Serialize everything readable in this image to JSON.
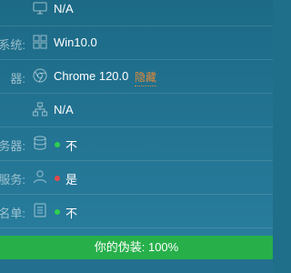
{
  "colors": {
    "background": "#1f6f8b",
    "accent_link": "#e08a3a",
    "status_bar": "#27b04a",
    "dot_green": "#2fcf4f",
    "dot_red": "#e24a4a"
  },
  "rows": [
    {
      "label": "",
      "icon": "monitor-icon",
      "value": "N/A"
    },
    {
      "label": "系统:",
      "icon": "windows-icon",
      "value": "Win10.0"
    },
    {
      "label": "器:",
      "icon": "chrome-icon",
      "value": "Chrome 120.0",
      "link": "隐藏"
    },
    {
      "label": "",
      "icon": "network-icon",
      "value": "N/A"
    },
    {
      "label": "服务器:",
      "icon": "database-icon",
      "status": "green",
      "value": "不"
    },
    {
      "label": "服务:",
      "icon": "user-icon",
      "status": "red",
      "value": "是"
    },
    {
      "label": "名单:",
      "icon": "list-icon",
      "status": "green",
      "value": "不"
    }
  ],
  "status_bar": {
    "label": "你的伪装: 100%",
    "disguise_percent": 100
  }
}
